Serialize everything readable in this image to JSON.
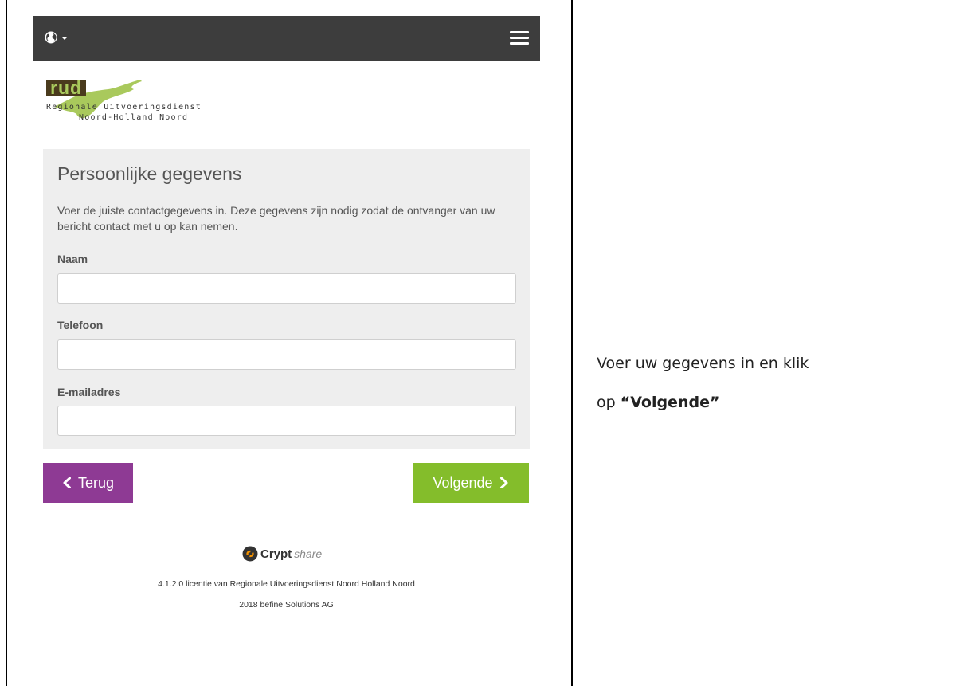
{
  "logo": {
    "abbr": "rud",
    "line1": "Regionale Uitvoeringsdienst",
    "line2": "Noord-Holland Noord"
  },
  "navbar": {
    "language_icon": "globe-icon",
    "menu_icon": "hamburger-icon"
  },
  "form": {
    "title": "Persoonlijke gegevens",
    "intro": "Voer de juiste contactgegevens in. Deze gegevens zijn nodig zodat de ontvanger van uw bericht contact met u op kan nemen.",
    "fields": [
      {
        "label": "Naam",
        "value": ""
      },
      {
        "label": "Telefoon",
        "value": ""
      },
      {
        "label": "E-mailadres",
        "value": ""
      }
    ]
  },
  "buttons": {
    "back_label": "Terug",
    "next_label": "Volgende",
    "back_color": "#8e3a94",
    "next_color": "#84bd2b"
  },
  "footer": {
    "brand_bold": "Crypt",
    "brand_light": "share",
    "license": "4.1.2.0 licentie van Regionale Uitvoeringsdienst Noord Holland Noord",
    "copyright": "2018 befine Solutions AG"
  },
  "instruction": {
    "line1": "Voer uw gegevens in en klik",
    "prefix": "op ",
    "emphasis": "“Volgende”"
  }
}
